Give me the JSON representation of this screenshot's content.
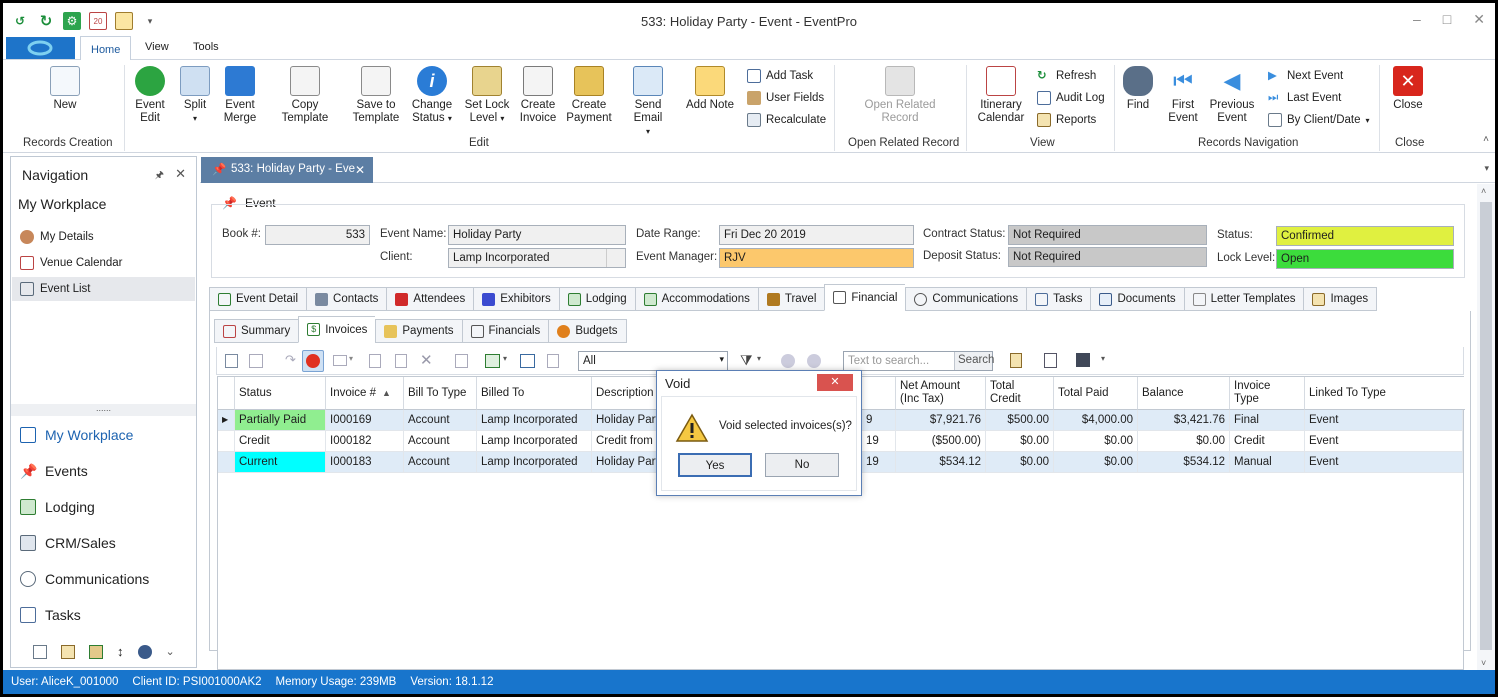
{
  "window": {
    "title": "533: Holiday Party - Event - EventPro"
  },
  "menu": {
    "tabs": [
      "Home",
      "View",
      "Tools"
    ]
  },
  "ribbon": {
    "new": "New",
    "records_creation": "Records Creation",
    "event_edit": [
      "Event",
      "Edit"
    ],
    "split": "Split",
    "event_merge": [
      "Event",
      "Merge"
    ],
    "copy_template": "Copy Template",
    "save_to_template": [
      "Save to",
      "Template"
    ],
    "change_status": [
      "Change",
      "Status"
    ],
    "set_lock_level": [
      "Set Lock",
      "Level"
    ],
    "create_invoice": [
      "Create",
      "Invoice"
    ],
    "create_payment": [
      "Create",
      "Payment"
    ],
    "send_email": "Send Email",
    "add_note": "Add Note",
    "add_task": "Add Task",
    "user_fields": "User Fields",
    "recalculate": "Recalculate",
    "edit_group": "Edit",
    "open_related": [
      "Open Related",
      "Record"
    ],
    "open_related_group": "Open Related Record",
    "itinerary_calendar": [
      "Itinerary",
      "Calendar"
    ],
    "refresh": "Refresh",
    "audit_log": "Audit Log",
    "reports": "Reports",
    "view_group": "View",
    "find": "Find",
    "first_event": [
      "First",
      "Event"
    ],
    "previous_event": [
      "Previous",
      "Event"
    ],
    "next_event": "Next Event",
    "last_event": "Last Event",
    "by_client_date": "By Client/Date",
    "records_navigation": "Records Navigation",
    "close": "Close",
    "close_group": "Close"
  },
  "navigation": {
    "title": "Navigation",
    "workplace": "My Workplace",
    "items": [
      "My Details",
      "Venue Calendar",
      "Event List"
    ],
    "splitter": "......",
    "modules": [
      "My Workplace",
      "Events",
      "Lodging",
      "CRM/Sales",
      "Communications",
      "Tasks"
    ]
  },
  "doc_tab": {
    "label": "533: Holiday Party - Eve"
  },
  "event": {
    "legend": "Event",
    "book_label": "Book #:",
    "book": "533",
    "event_name_label": "Event Name:",
    "event_name": "Holiday Party",
    "client_label": "Client:",
    "client": "Lamp Incorporated",
    "date_range_label": "Date Range:",
    "date_range": "Fri Dec 20 2019",
    "event_manager_label": "Event Manager:",
    "event_manager": "RJV",
    "contract_status_label": "Contract Status:",
    "contract_status": "Not Required",
    "deposit_status_label": "Deposit Status:",
    "deposit_status": "Not Required",
    "status_label": "Status:",
    "status": "Confirmed",
    "lock_level_label": "Lock Level:",
    "lock_level": "Open"
  },
  "main_tabs": [
    "Event Detail",
    "Contacts",
    "Attendees",
    "Exhibitors",
    "Lodging",
    "Accommodations",
    "Travel",
    "Financial",
    "Communications",
    "Tasks",
    "Documents",
    "Letter Templates",
    "Images"
  ],
  "financial_tabs": [
    "Summary",
    "Invoices",
    "Payments",
    "Financials",
    "Budgets"
  ],
  "toolbar": {
    "filter_value": "All",
    "search_placeholder": "Text to search...",
    "search_button": "Search"
  },
  "grid": {
    "columns": [
      "Status",
      "Invoice #",
      "Bill To Type",
      "Billed To",
      "Description",
      "Net Amount\n(Inc Tax)",
      "Total\nCredit",
      "Total Paid",
      "Balance",
      "Invoice\nType",
      "Linked To Type"
    ],
    "rows": [
      {
        "status": "Partially Paid",
        "status_color": "#90ee90",
        "invoice": "I000169",
        "bill_to_type": "Account",
        "billed_to": "Lamp Incorporated",
        "description": "Holiday Part",
        "date_tail": "9",
        "net": "$7,921.76",
        "credit": "$500.00",
        "paid": "$4,000.00",
        "balance": "$3,421.76",
        "type": "Final",
        "linked": "Event"
      },
      {
        "status": "Credit",
        "status_color": "",
        "invoice": "I000182",
        "bill_to_type": "Account",
        "billed_to": "Lamp Incorporated",
        "description": "Credit from",
        "date_tail": "19",
        "net": "($500.00)",
        "credit": "$0.00",
        "paid": "$0.00",
        "balance": "$0.00",
        "type": "Credit",
        "linked": "Event"
      },
      {
        "status": "Current",
        "status_color": "#00ffff",
        "invoice": "I000183",
        "bill_to_type": "Account",
        "billed_to": "Lamp Incorporated",
        "description": "Holiday Part",
        "date_tail": "19",
        "net": "$534.12",
        "credit": "$0.00",
        "paid": "$0.00",
        "balance": "$534.12",
        "type": "Manual",
        "linked": "Event"
      }
    ]
  },
  "dialog": {
    "title": "Void",
    "message": "Void selected invoices(s)?",
    "yes": "Yes",
    "no": "No"
  },
  "statusbar": {
    "user": "User: AliceK_001000",
    "client_id": "Client ID: PSI001000AK2",
    "memory": "Memory Usage: 239MB",
    "version": "Version: 18.1.12"
  },
  "colors": {
    "accent": "#1875cc",
    "status_yellow": "#e0f040",
    "lock_green": "#3cdc3c",
    "manager_orange": "#fcc86c",
    "disabled_gray": "#c8c8c8"
  }
}
